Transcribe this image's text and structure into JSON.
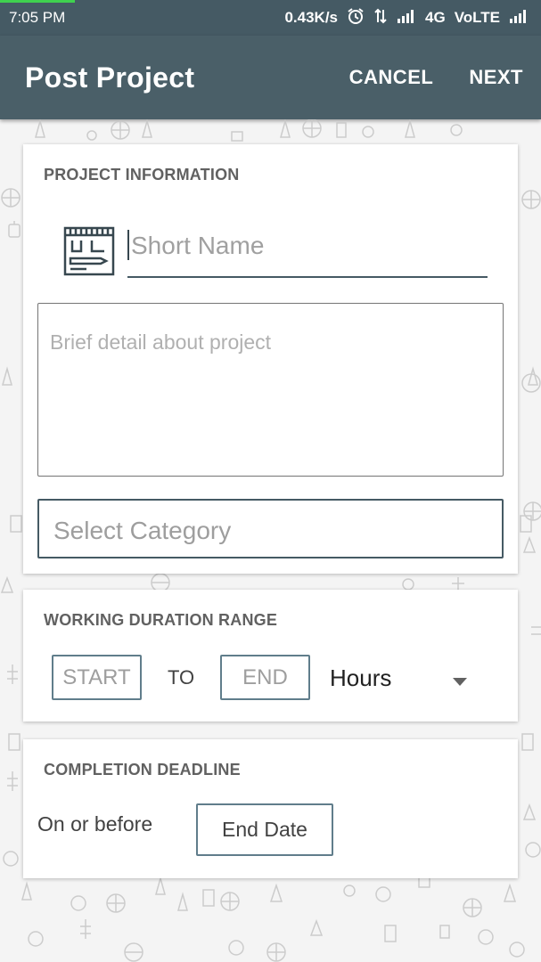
{
  "status_bar": {
    "time": "7:05 PM",
    "speed": "0.43K/s",
    "network": "4G",
    "volte": "VoLTE",
    "icons": [
      "alarm-icon",
      "data-transfer-icon",
      "signal-icon",
      "signal-icon-2"
    ]
  },
  "app_bar": {
    "title": "Post Project",
    "cancel_label": "CANCEL",
    "next_label": "NEXT"
  },
  "project_info": {
    "heading": "PROJECT INFORMATION",
    "short_name_placeholder": "Short Name",
    "detail_placeholder": "Brief detail about project",
    "category_placeholder": "Select Category",
    "icon": "blueprint-icon"
  },
  "duration": {
    "heading": "WORKING DURATION RANGE",
    "start_placeholder": "START",
    "to_label": "TO",
    "end_placeholder": "END",
    "unit_selected": "Hours"
  },
  "deadline": {
    "heading": "COMPLETION DEADLINE",
    "on_or_before": "On or before",
    "end_date_label": "End Date"
  },
  "colors": {
    "app_bar": "#4a5f68",
    "status_bar": "#455a64",
    "accent": "#455a64"
  }
}
